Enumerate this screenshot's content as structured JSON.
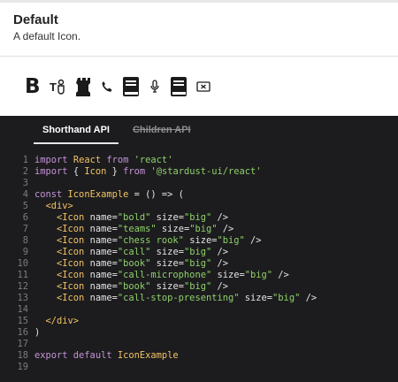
{
  "example": {
    "title": "Default",
    "description": "A default Icon."
  },
  "preview_icons": [
    {
      "name": "bold",
      "glyph": "B"
    },
    {
      "name": "teams",
      "glyph": "T"
    },
    {
      "name": "chess rook",
      "glyph": "♜"
    },
    {
      "name": "call",
      "glyph": "✆"
    },
    {
      "name": "book",
      "glyph": ""
    },
    {
      "name": "call-microphone",
      "glyph": ""
    },
    {
      "name": "book",
      "glyph": ""
    },
    {
      "name": "call-stop-presenting",
      "glyph": ""
    }
  ],
  "tabs": {
    "shorthand": "Shorthand API",
    "children": "Children API"
  },
  "code": {
    "line_numbers": [
      "1",
      "2",
      "3",
      "4",
      "5",
      "6",
      "7",
      "8",
      "9",
      "10",
      "11",
      "12",
      "13",
      "14",
      "15",
      "16",
      "17",
      "18",
      "19"
    ],
    "l1_import": "import",
    "l1_react": "React",
    "l1_from": "from",
    "l1_str": "'react'",
    "l2_import": "import",
    "l2_open": "{ ",
    "l2_icon": "Icon",
    "l2_close": " }",
    "l2_from": "from",
    "l2_str": "'@stardust-ui/react'",
    "l4_const": "const",
    "l4_name": "IconExample",
    "l4_rest": " = () => (",
    "l5_div": "<div>",
    "icon_tag": "<Icon",
    "attr_name": "name=",
    "attr_size": "size=",
    "size_big": "\"big\"",
    "close_tag": " />",
    "icon_names": [
      "\"bold\"",
      "\"teams\"",
      "\"chess rook\"",
      "\"call\"",
      "\"book\"",
      "\"call-microphone\"",
      "\"book\"",
      "\"call-stop-presenting\""
    ],
    "l15_div": "</div>",
    "l16_paren": ")",
    "l18_export": "export default",
    "l18_name": "IconExample"
  }
}
